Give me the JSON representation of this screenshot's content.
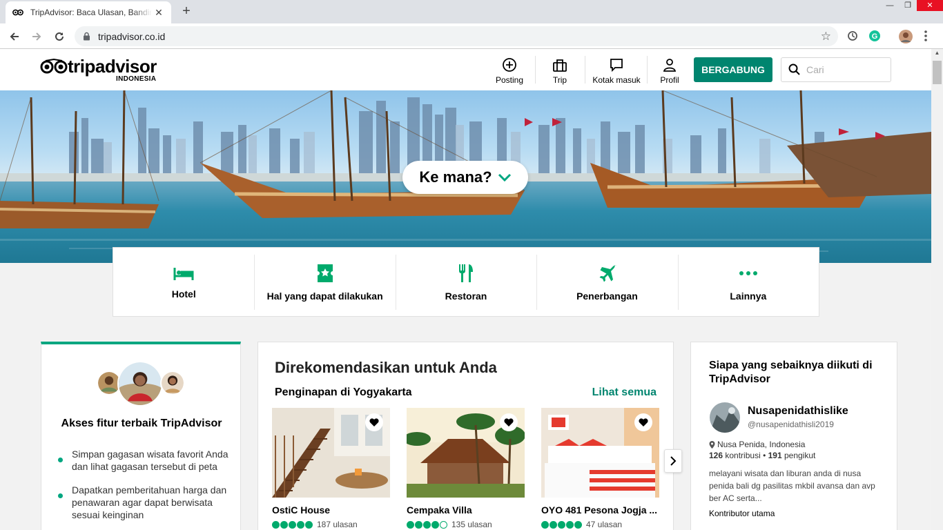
{
  "browser": {
    "tab_title": "TripAdvisor: Baca Ulasan, Banding",
    "url": "tripadvisor.co.id"
  },
  "header": {
    "logo_text": "tripadvisor",
    "logo_sub": "INDONESIA",
    "nav": [
      {
        "label": "Posting",
        "icon": "plus-circle-icon"
      },
      {
        "label": "Trip",
        "icon": "suitcase-icon"
      },
      {
        "label": "Kotak masuk",
        "icon": "message-icon"
      },
      {
        "label": "Profil",
        "icon": "person-icon"
      }
    ],
    "join_label": "BERGABUNG",
    "search_placeholder": "Cari"
  },
  "hero": {
    "where_label": "Ke mana?"
  },
  "categories": [
    {
      "label": "Hotel",
      "icon": "bed-icon"
    },
    {
      "label": "Hal yang dapat dilakukan",
      "icon": "ticket-icon"
    },
    {
      "label": "Restoran",
      "icon": "cutlery-icon"
    },
    {
      "label": "Penerbangan",
      "icon": "plane-icon"
    },
    {
      "label": "Lainnya",
      "icon": "more-dots-icon"
    }
  ],
  "left_card": {
    "title": "Akses fitur terbaik TripAdvisor",
    "bullets": [
      "Simpan gagasan wisata favorit Anda dan lihat gagasan tersebut di peta",
      "Dapatkan pemberitahuan harga dan penawaran agar dapat berwisata sesuai keinginan"
    ]
  },
  "recommend": {
    "title": "Direkomendasikan untuk Anda",
    "subtitle": "Penginapan di Yogyakarta",
    "see_all": "Lihat semua",
    "hotels": [
      {
        "name": "OstiC House",
        "rating": 5,
        "reviews": "187 ulasan"
      },
      {
        "name": "Cempaka Villa",
        "rating": 4,
        "reviews": "135 ulasan"
      },
      {
        "name": "OYO 481 Pesona Jogja ...",
        "rating": 5,
        "reviews": "47 ulasan"
      }
    ]
  },
  "follow": {
    "title": "Siapa yang sebaiknya diikuti di TripAdvisor",
    "name": "Nusapenidathislike",
    "handle": "@nusapenidathisli2019",
    "location": "Nusa Penida, Indonesia",
    "contributions": "126",
    "contributions_label": "kontribusi",
    "followers": "191",
    "followers_label": "pengikut",
    "description": "melayani wisata dan liburan anda di nusa penida bali dg pasilitas mkbil avansa dan avp ber AC serta...",
    "tag": "Kontributor utama"
  },
  "colors": {
    "brand_green": "#00856f",
    "accent_green": "#00a680",
    "bubble_green": "#00aa6c"
  }
}
